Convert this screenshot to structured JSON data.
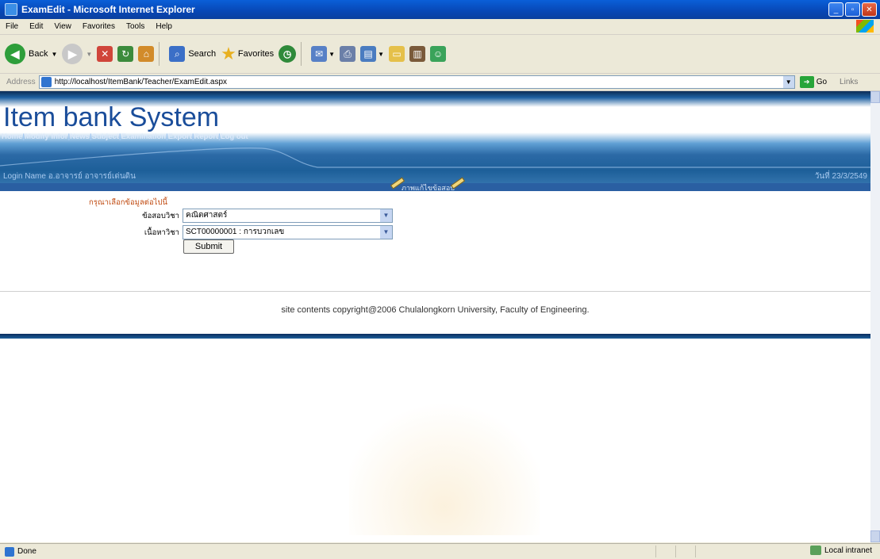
{
  "window": {
    "title": "ExamEdit - Microsoft Internet Explorer"
  },
  "menu": [
    "File",
    "Edit",
    "View",
    "Favorites",
    "Tools",
    "Help"
  ],
  "toolbar": {
    "back": "Back",
    "search": "Search",
    "favorites": "Favorites"
  },
  "address": {
    "label": "Address",
    "url": "http://localhost/ItemBank/Teacher/ExamEdit.aspx",
    "go": "Go",
    "links": "Links"
  },
  "site": {
    "title": "Item bank System",
    "nav": [
      "Home",
      "Modify Infor",
      "News",
      "Subject",
      "Examination",
      "Export",
      "Report",
      "Log out"
    ],
    "login": "Login Name  อ.อาจารย์ อาจารย์เด่นดิน",
    "date": "วันที่ 23/3/2549",
    "edit_label": "ภาพแก้ไขข้อสอบ"
  },
  "form": {
    "prompt": "กรุณาเลือกข้อมูลต่อไปนี้",
    "subject_label": "ข้อสอบวิชา",
    "subject_value": "คณิตศาสตร์",
    "content_label": "เนื้อหาวิชา",
    "content_value": "SCT00000001  : การบวกเลข",
    "submit": "Submit"
  },
  "footer": {
    "copyright": "site contents copyright@2006 Chulalongkorn University, Faculty of Engineering."
  },
  "status": {
    "left": "Done",
    "zone": "Local intranet"
  }
}
